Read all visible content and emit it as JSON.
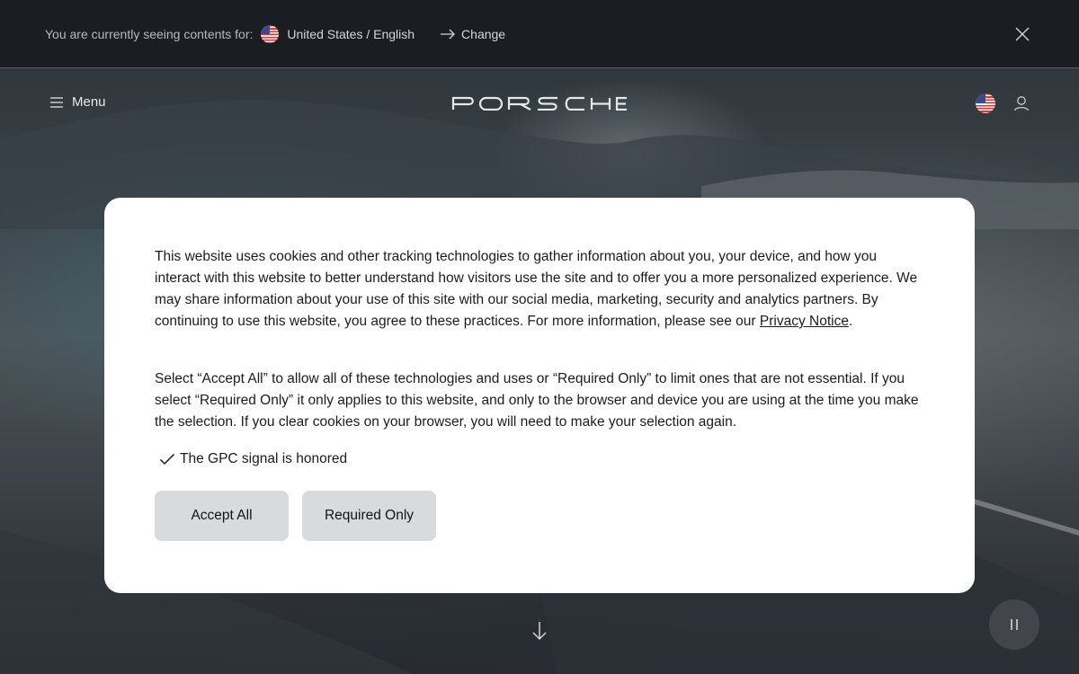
{
  "region_bar": {
    "lead_text": "You are currently seeing contents for:",
    "country": "United States / English",
    "change_label": "Change",
    "flag_icon": "us-flag-icon",
    "close_icon": "close-icon"
  },
  "header": {
    "menu_label": "Menu",
    "brand": "PORSCHE",
    "flag_icon": "us-flag-icon",
    "user_icon": "user-icon"
  },
  "cookie_modal": {
    "paragraph_1": "This website uses cookies and other tracking technologies to gather information about you, your device, and how you interact with this website to better understand how visitors use the site and to offer you a more personalized experience. We may share information about your use of this site with our social media, marketing, security and analytics partners. By continuing to use this website, you agree to these practices. For more information, please see our ",
    "privacy_link": "Privacy Notice",
    "paragraph_1_end": ".",
    "paragraph_2": "Select “Accept All” to allow all of these technologies and uses or “Required Only” to limit ones that are not essential. If you select “Required Only” it only applies to this website, and only to the browser and device you are using at the time you make the selection. If you clear cookies on your browser, you will need to make your selection again.",
    "gpc_text": "The GPC signal is honored",
    "accept_all_label": "Accept All",
    "required_only_label": "Required Only"
  },
  "controls": {
    "scroll_icon": "arrow-down-icon",
    "pause_icon": "pause-icon"
  },
  "colors": {
    "region_bar_bg": "#1a1d22",
    "modal_bg": "#ffffff",
    "button_bg": "#d9dadc",
    "text_dark": "#1a1c1f"
  }
}
